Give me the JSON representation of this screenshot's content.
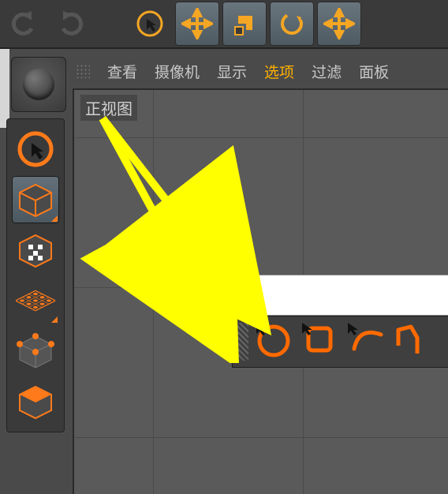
{
  "top_toolbar": {
    "buttons": [
      "undo",
      "redo",
      "select",
      "move",
      "scale",
      "rotate",
      "move2"
    ]
  },
  "menu": {
    "items": [
      "查看",
      "摄像机",
      "显示",
      "选项",
      "过滤",
      "面板"
    ],
    "active_index": 3
  },
  "viewport": {
    "label": "正视图"
  },
  "side_tools": {
    "items": [
      "live-select",
      "model",
      "texture",
      "workplane",
      "points",
      "uv"
    ],
    "selected_index": 1
  },
  "spline_toolbar": {
    "items": [
      "freehand-circle",
      "rectangle",
      "arc",
      "polygon"
    ]
  },
  "colors": {
    "accent": "#ff7a1a",
    "highlight": "#f5a623"
  }
}
